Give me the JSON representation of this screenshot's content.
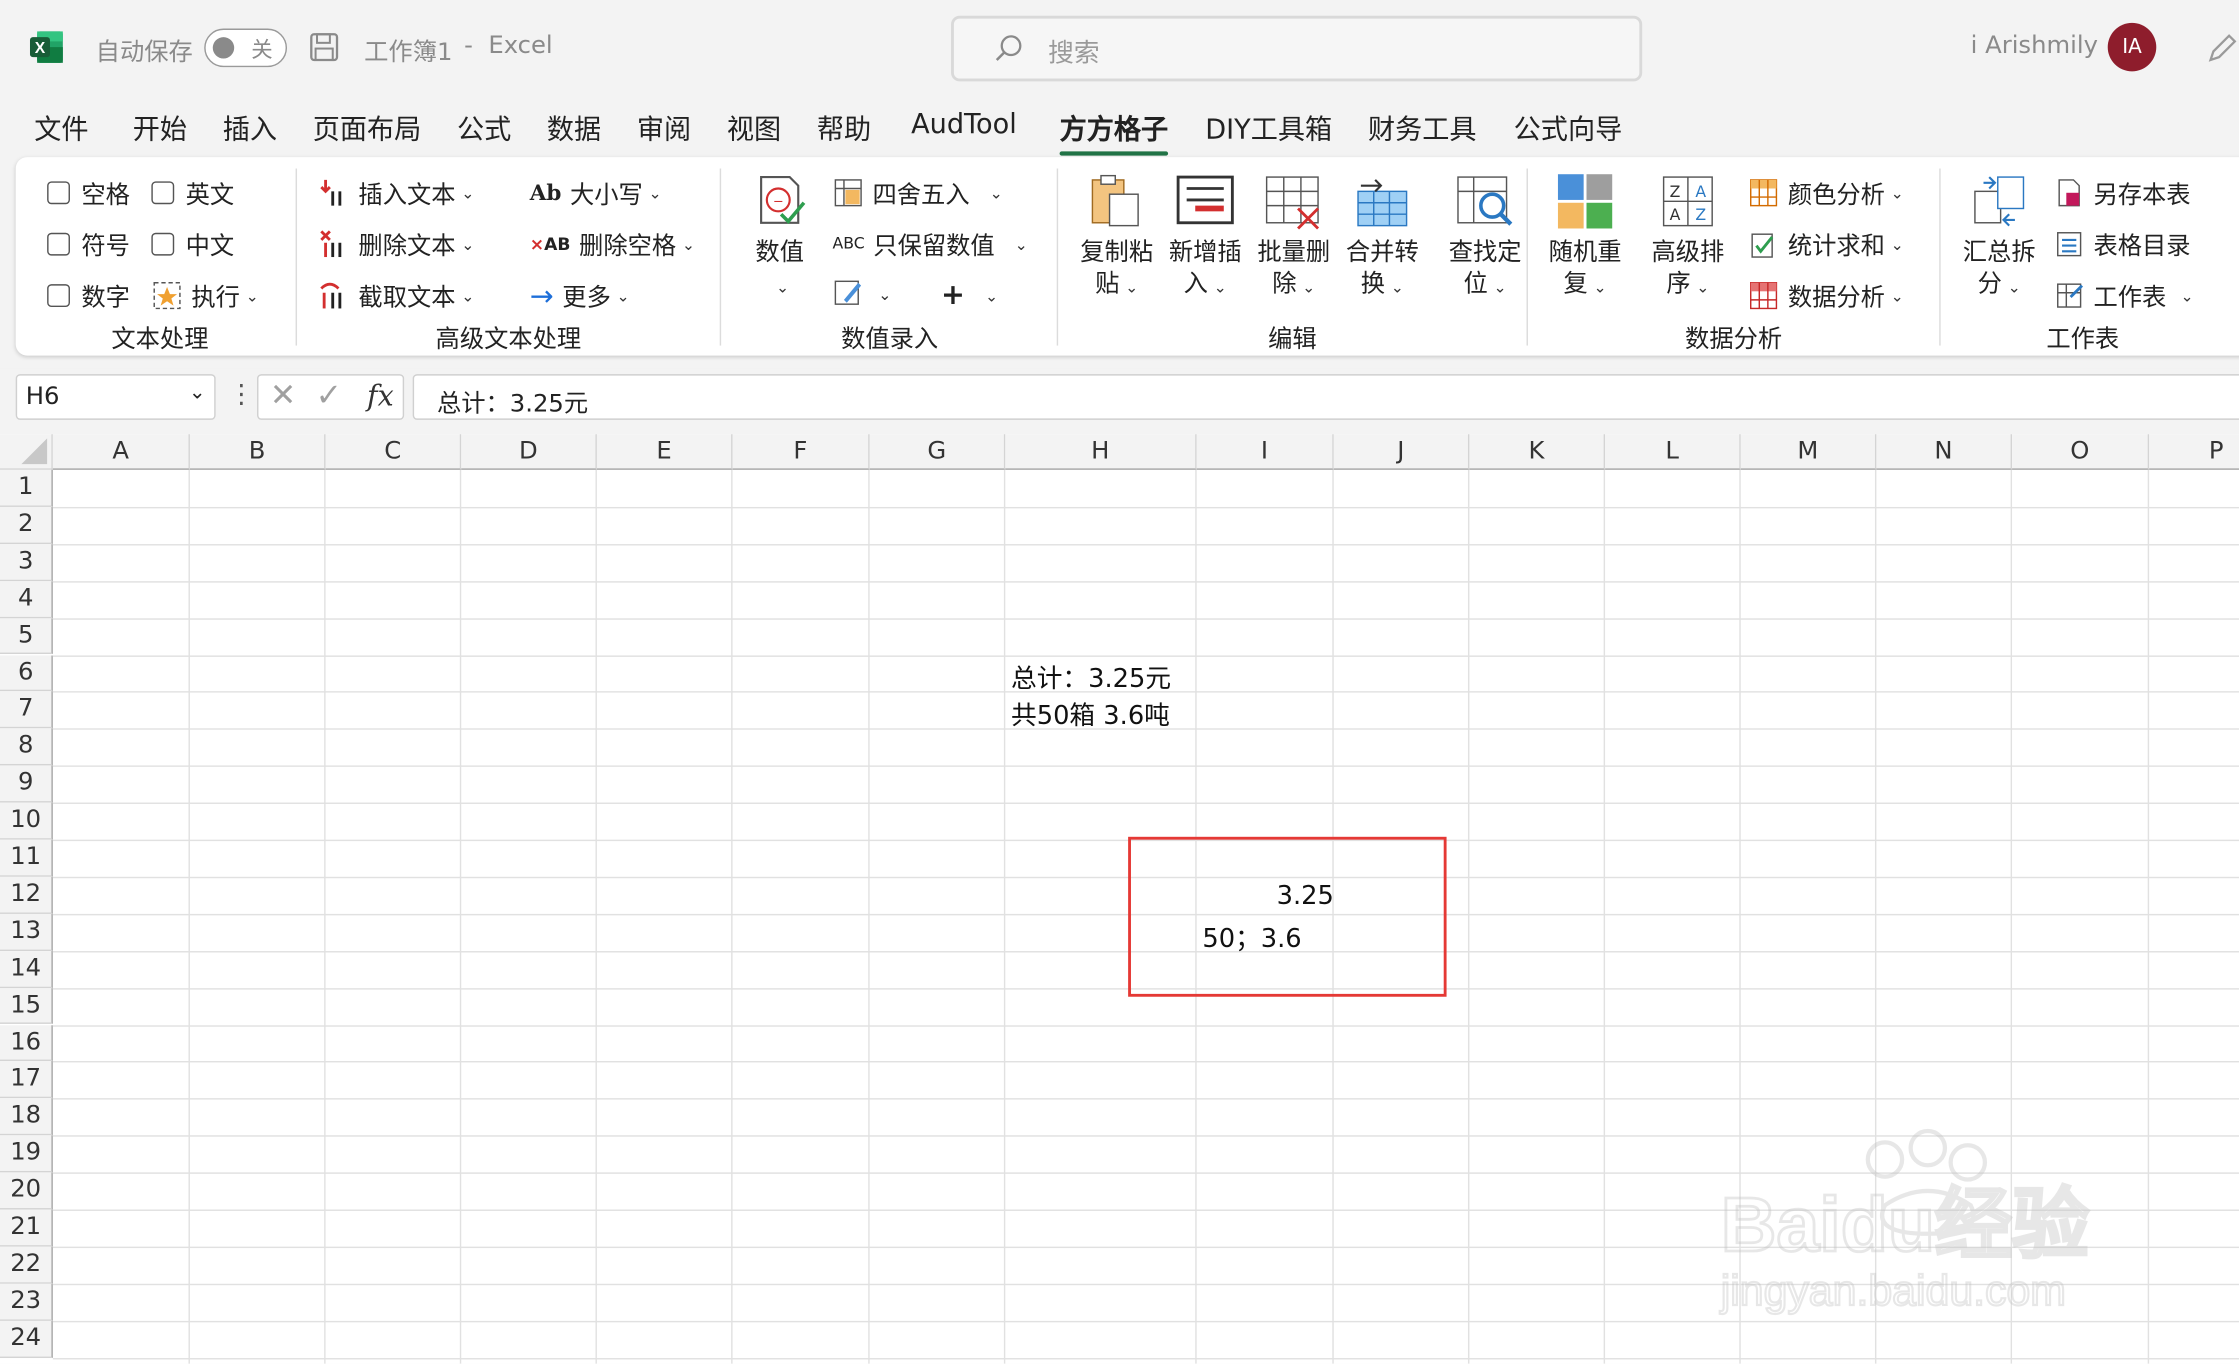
{
  "titlebar": {
    "autosave_label": "自动保存",
    "autosave_state": "关",
    "doc_title": "工作簿1",
    "separator": "-",
    "app_name": "Excel",
    "search_placeholder": "搜索",
    "user_name": "i Arishmily",
    "avatar_initials": "IA",
    "avatar_color": "#8e1d2c"
  },
  "tabs": [
    "文件",
    "开始",
    "插入",
    "页面布局",
    "公式",
    "数据",
    "审阅",
    "视图",
    "帮助",
    "AudTool",
    "方方格子",
    "DIY工具箱",
    "财务工具",
    "公式向导"
  ],
  "active_tab": "方方格子",
  "ribbon": {
    "text_processing": {
      "label": "文本处理",
      "checkboxes": [
        "空格",
        "英文",
        "符号",
        "中文",
        "数字"
      ],
      "execute": "执行"
    },
    "advanced_text": {
      "label": "高级文本处理",
      "insert_text": "插入文本",
      "delete_text": "删除文本",
      "extract_text": "截取文本",
      "case": "大小写",
      "delete_spaces": "删除空格",
      "more": "更多"
    },
    "data_entry": {
      "label": "数值录入",
      "value": "数值",
      "round": "四舍五入",
      "keep_numbers": "只保留数值"
    },
    "edit": {
      "label": "编辑",
      "copy_paste": [
        "复制粘",
        "贴"
      ],
      "new_insert": [
        "新增插",
        "入"
      ],
      "batch_delete": [
        "批量删",
        "除"
      ],
      "merge_convert": [
        "合并转",
        "换"
      ],
      "find_locate": [
        "查找定",
        "位"
      ]
    },
    "data_analysis": {
      "label": "数据分析",
      "random_repeat": [
        "随机重",
        "复"
      ],
      "advanced_sort": [
        "高级排",
        "序"
      ],
      "color_analysis": "颜色分析",
      "count_sum": "统计求和",
      "data_analysis": "数据分析"
    },
    "worksheet": {
      "label": "工作表",
      "summary_split": [
        "汇总拆",
        "分"
      ],
      "save_as": "另存本表",
      "toc": "表格目录",
      "worksheet": "工作表"
    }
  },
  "formula_bar": {
    "name_box": "H6",
    "fx_label": "fx",
    "content": "总计：3.25元"
  },
  "grid": {
    "columns": [
      "A",
      "B",
      "C",
      "D",
      "E",
      "F",
      "G",
      "H",
      "I",
      "J",
      "K",
      "L",
      "M",
      "N",
      "O",
      "P"
    ],
    "rows": [
      "1",
      "2",
      "3",
      "4",
      "5",
      "6",
      "7",
      "8",
      "9",
      "10",
      "11",
      "12",
      "13",
      "14",
      "15",
      "16",
      "17",
      "18",
      "19",
      "20",
      "21",
      "22",
      "23",
      "24"
    ],
    "cells": {
      "H6": "总计：3.25元",
      "H7": "共50箱 3.6吨",
      "I12": "3.25",
      "H13": "50；3.6"
    }
  },
  "watermark": {
    "brand": "Baidu经验",
    "url": "jingyan.baidu.com"
  }
}
